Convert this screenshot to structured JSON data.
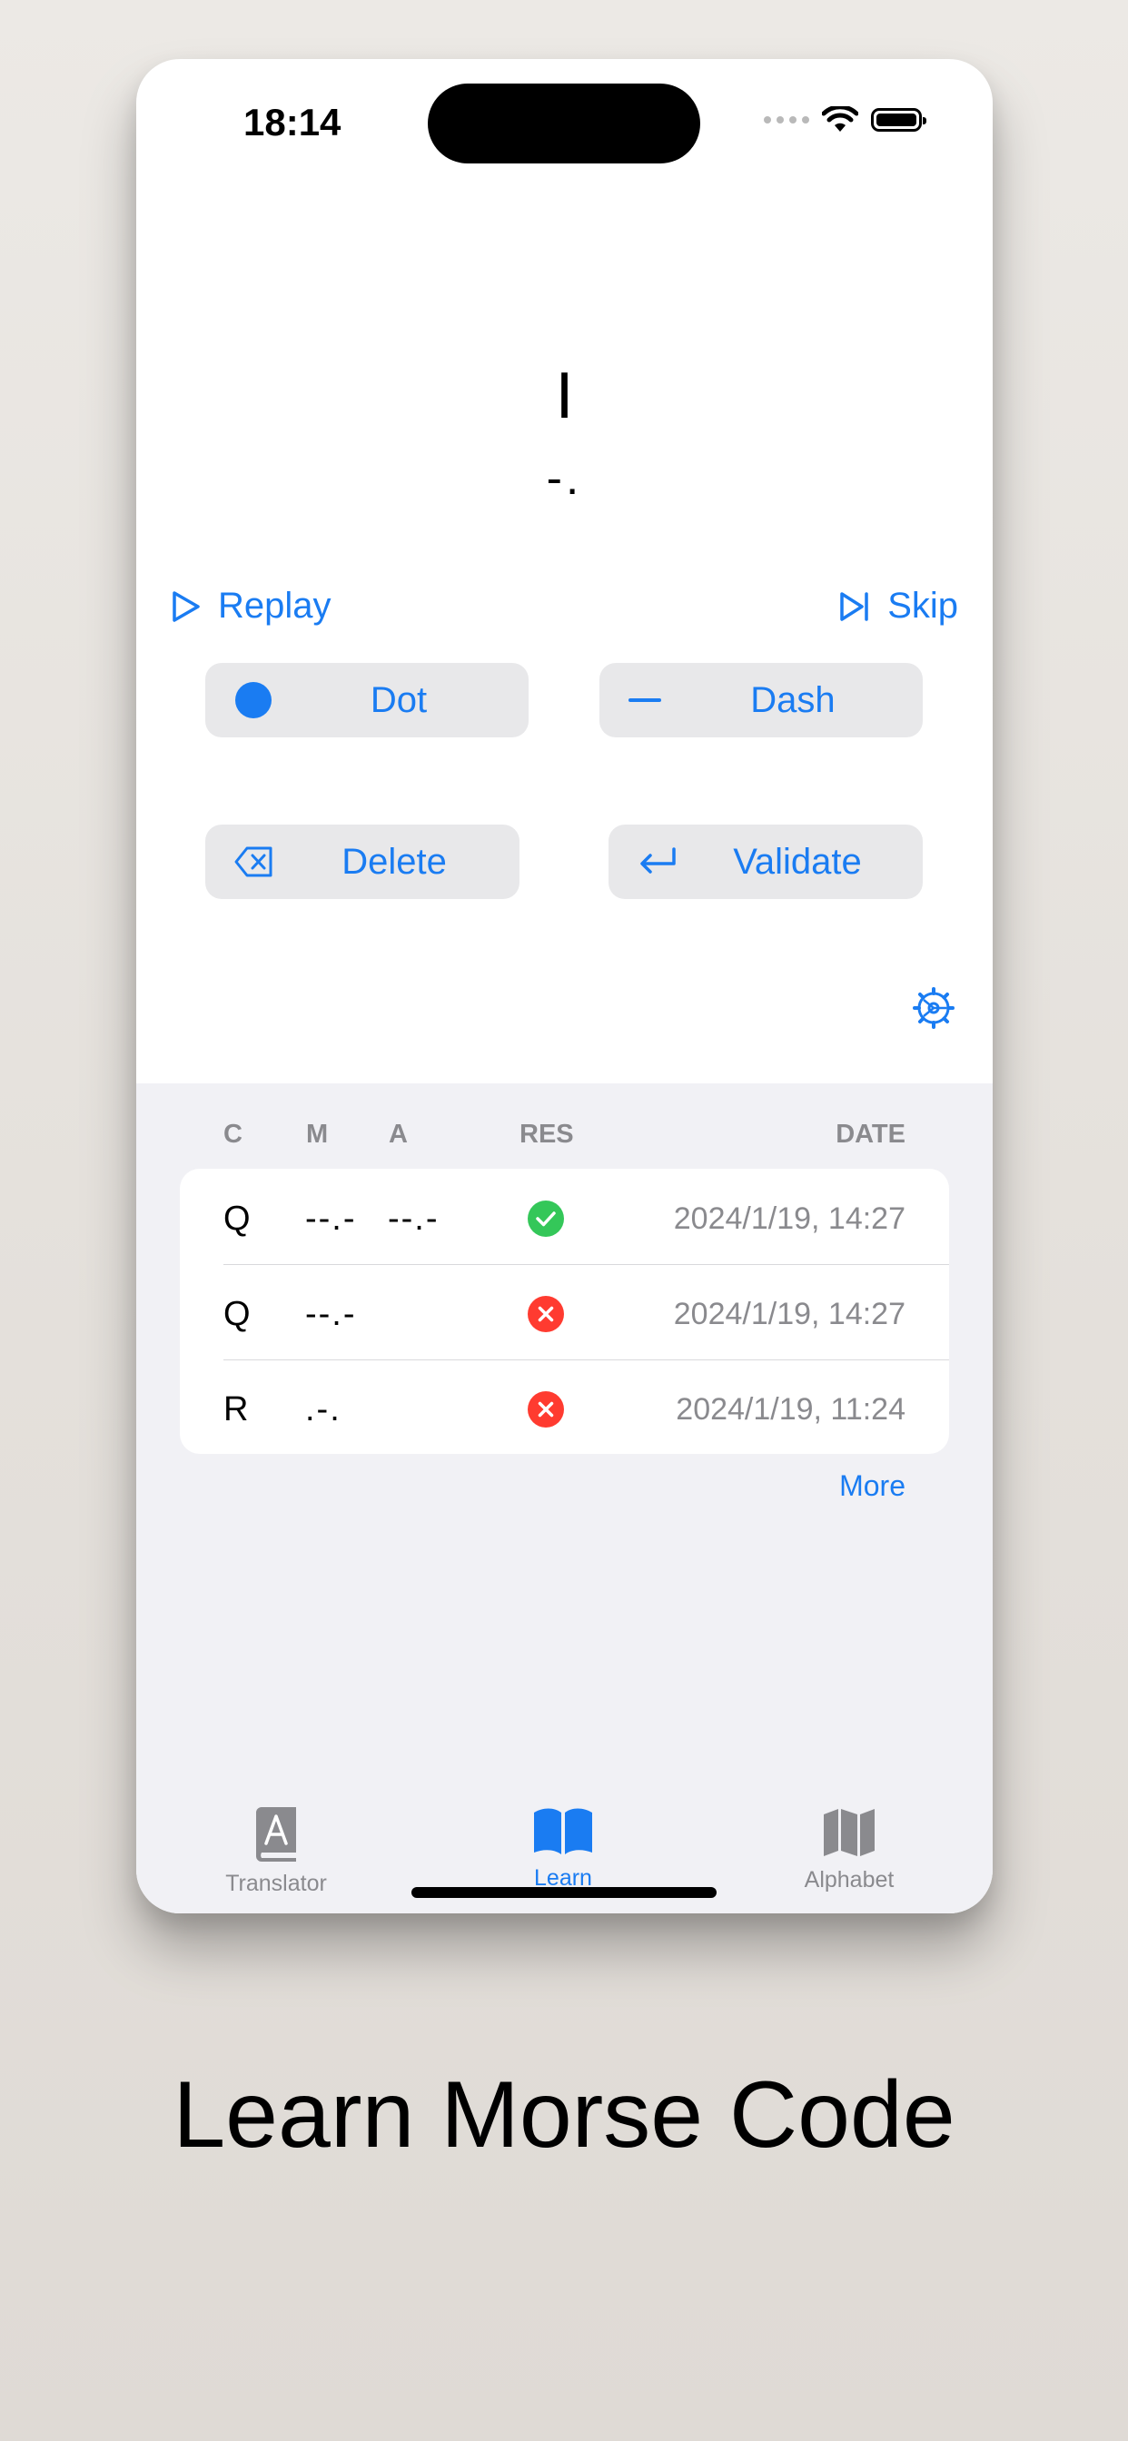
{
  "status_bar": {
    "time": "18:14"
  },
  "challenge": {
    "letter": "I",
    "morse": "-."
  },
  "actions": {
    "replay_label": "Replay",
    "skip_label": "Skip"
  },
  "keypad": {
    "dot_label": "Dot",
    "dash_label": "Dash",
    "delete_label": "Delete",
    "validate_label": "Validate"
  },
  "history": {
    "columns": {
      "c": "C",
      "m": "M",
      "a": "A",
      "res": "RES",
      "date": "DATE"
    },
    "rows": [
      {
        "c": "Q",
        "m": "--.-",
        "a": "--.-",
        "result": "correct",
        "date": "2024/1/19, 14:27"
      },
      {
        "c": "Q",
        "m": "--.-",
        "a": "",
        "result": "wrong",
        "date": "2024/1/19, 14:27"
      },
      {
        "c": "R",
        "m": ".-.",
        "a": "",
        "result": "wrong",
        "date": "2024/1/19, 11:24"
      }
    ],
    "more_label": "More"
  },
  "tabs": [
    {
      "label": "Translator",
      "icon": "dictionary-book-icon",
      "active": false
    },
    {
      "label": "Learn",
      "icon": "open-book-icon",
      "active": true
    },
    {
      "label": "Alphabet",
      "icon": "map-icon",
      "active": false
    }
  ],
  "colors": {
    "accent": "#1a7cf2",
    "success": "#34c759",
    "error": "#ff3b30"
  },
  "marketing": {
    "headline": "Learn Morse Code"
  }
}
